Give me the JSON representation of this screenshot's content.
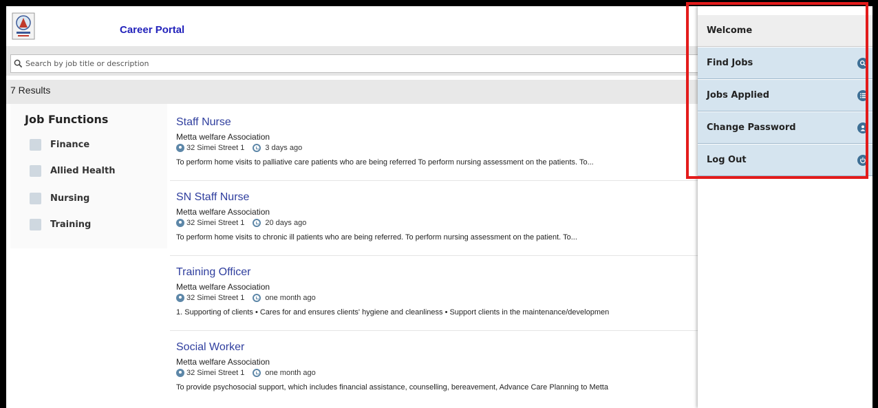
{
  "header": {
    "title": "Career Portal",
    "logo_icon": "organization-logo-icon"
  },
  "search": {
    "placeholder": "Search by job title or description",
    "value": ""
  },
  "results": {
    "count_label": "7 Results"
  },
  "job_functions": {
    "title": "Job Functions",
    "items": [
      {
        "label": "Finance",
        "checked": false
      },
      {
        "label": "Allied Health",
        "checked": false
      },
      {
        "label": "Nursing",
        "checked": false
      },
      {
        "label": "Training",
        "checked": false
      }
    ]
  },
  "jobs": [
    {
      "title": "Staff Nurse",
      "company": "Metta welfare Association",
      "location": "32 Simei Street 1",
      "posted": "3 days ago",
      "description": "To perform home visits to palliative care patients who are being referred To perform nursing assessment on the patients. To..."
    },
    {
      "title": "SN Staff Nurse",
      "company": "Metta welfare Association",
      "location": "32 Simei Street 1",
      "posted": "20 days ago",
      "description": "To perform home visits to chronic ill patients who are being referred. To perform nursing assessment on the patient. To..."
    },
    {
      "title": "Training Officer",
      "company": "Metta welfare Association",
      "location": "32 Simei Street 1",
      "posted": "one month ago",
      "description": "1. Supporting of clients • Cares for and ensures clients' hygiene and cleanliness • Support clients in the maintenance/developmen"
    },
    {
      "title": "Social Worker",
      "company": "Metta welfare Association",
      "location": "32 Simei Street 1",
      "posted": "one month ago",
      "description": "To provide psychosocial support, which includes financial assistance, counselling, bereavement, Advance Care Planning to Metta"
    }
  ],
  "side_menu": {
    "welcome": "Welcome",
    "items": [
      {
        "label": "Find Jobs",
        "icon": "search-icon"
      },
      {
        "label": "Jobs Applied",
        "icon": "list-icon"
      },
      {
        "label": "Change Password",
        "icon": "user-icon"
      },
      {
        "label": "Log Out",
        "icon": "power-icon"
      }
    ]
  },
  "colors": {
    "title_blue": "#2222bb",
    "job_title": "#2f3e9e",
    "menu_blue": "#d5e4ef",
    "icon_blue": "#3d6f95",
    "highlight_red": "#e31b1b"
  }
}
